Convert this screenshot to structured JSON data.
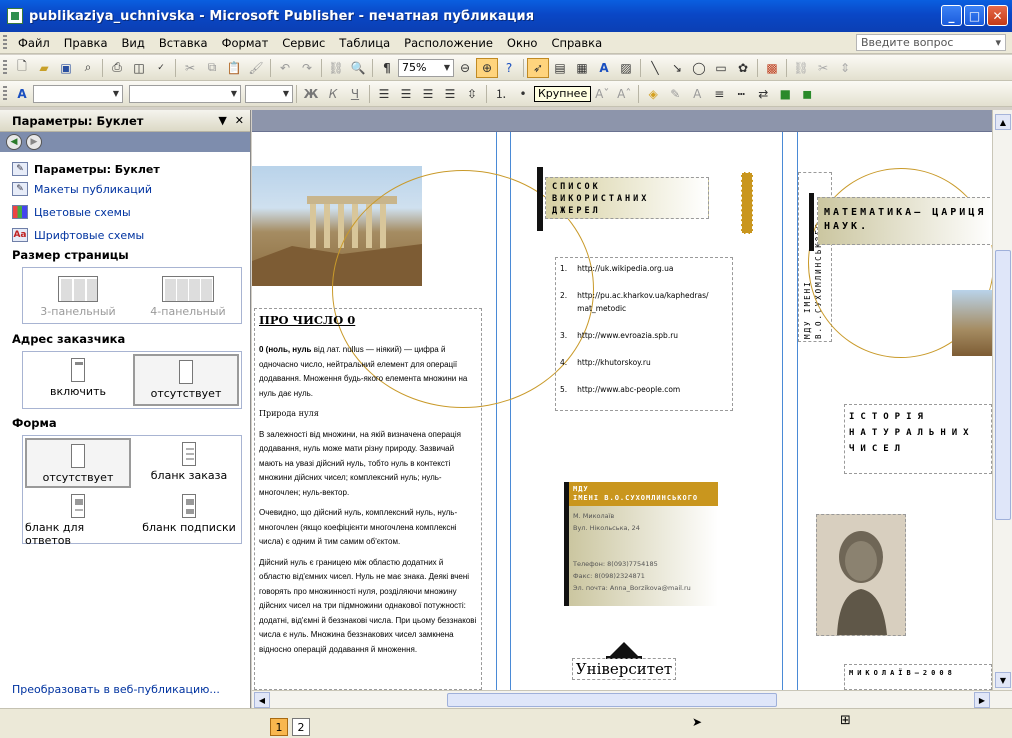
{
  "window": {
    "title": "publikaziya_uchnivska - Microsoft Publisher - печатная публикация",
    "minimize": "_",
    "maximize": "□",
    "close": "✕"
  },
  "menu": {
    "items": [
      "Файл",
      "Правка",
      "Вид",
      "Вставка",
      "Формат",
      "Сервис",
      "Таблица",
      "Расположение",
      "Окно",
      "Справка"
    ],
    "help_placeholder": "Введите вопрос"
  },
  "toolbar": {
    "zoom": "75%",
    "tooltip": "Крупнее",
    "bold": "Ж",
    "italic": "К",
    "underline": "Ч"
  },
  "taskpane": {
    "title": "Параметры: Буклет",
    "close": "✕",
    "links": [
      "Параметры: Буклет",
      "Макеты публикаций",
      "Цветовые схемы",
      "Шрифтовые схемы"
    ],
    "page_size": {
      "heading": "Размер страницы",
      "options": [
        "3-панельный",
        "4-панельный"
      ]
    },
    "customer_address": {
      "heading": "Адрес заказчика",
      "options": [
        "включить",
        "отсутствует"
      ]
    },
    "form": {
      "heading": "Форма",
      "options": [
        "отсутствует",
        "бланк заказа",
        "бланк для ответов",
        "бланк подписки"
      ]
    },
    "footer_link": "Преобразовать в веб-публикацию..."
  },
  "publication": {
    "article_title": "ПРО ЧИСЛО 0",
    "p1_bold": "0 (ноль, нуль",
    "p1": " від лат. nullus — ніякий) — цифра й одночасно число, нейтральний елемент для операції додавання. Множення будь-якого елемента множини на нуль дає нуль.",
    "p2": "Природа нуля",
    "p3": "В залежності від множини, на якій визначена операція додавання, нуль може мати різну природу. Зазвичай мають на увазі дійсний нуль, тобто нуль в контексті множини дійсних чисел; комплексний нуль; нуль-многочлен; нуль-вектор.",
    "p4": "Очевидно, що дійсний нуль, комплексний нуль, нуль-многочлен (якщо коефіцієнти многочлена комплексні числа) є одним й тим самим об'єктом.",
    "p5": "Дійсний нуль є границею між областю додатних й областю від'ємних чисел. Нуль не має знака. Деякі вчені говорять про множинності нуля, розділяючи множину дійсних чисел на три підмножини однакової потужності: додатні, від'ємні й беззнакові числа. При цьому беззнакові числа є нуль. Множина беззнакових чисел замкнена відносно операцій додавання й множення.",
    "sources_title": "СПИСОК ВИКОРИСТАНИХ ДЖЕРЕЛ",
    "sources": [
      {
        "n": "1.",
        "url": "http://uk.wikipedia.org.ua"
      },
      {
        "n": "2.",
        "url": "http://pu.ac.kharkov.ua/kaphedras/ mat_metodic"
      },
      {
        "n": "3.",
        "url": "http://www.evroazia.spb.ru"
      },
      {
        "n": "4.",
        "url": "http://khutorskoy.ru"
      },
      {
        "n": "5.",
        "url": "http://www.abc-people.com"
      }
    ],
    "contact": {
      "org_line1": "МДУ",
      "org_line2": "ІМЕНІ В.О.СУХОМЛИНСЬКОГО",
      "city": "М. Миколаїв",
      "street": "Вул. Нікольська, 24",
      "phone": "Телефон: 8(093)7754185",
      "fax": "Факс: 8(098)2324871",
      "email": "Эл. почта: Anna_Borzikova@mail.ru"
    },
    "university_label": "Університет",
    "vertical_org": "МДУ ІМЕНІ В.О.СУХОМЛИНСЬКОГО",
    "cover_title": "МАТЕМАТИКА— ЦАРИЦЯ НАУК.",
    "cover_subtitle": "ІСТОРІЯ НАТУРАЛЬНИХ ЧИСЕЛ",
    "cover_footer": "МИКОЛАЇВ—2008"
  },
  "status": {
    "pages": [
      "1",
      "2"
    ]
  }
}
